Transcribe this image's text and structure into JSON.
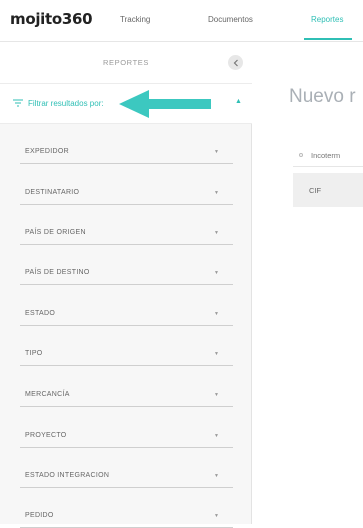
{
  "app": {
    "logo": "mojito360"
  },
  "nav": {
    "items": [
      {
        "label": "Tracking"
      },
      {
        "label": "Documentos"
      },
      {
        "label": "Reportes",
        "active": true
      }
    ]
  },
  "sidebar": {
    "title": "REPORTES",
    "filter_label": "Filtrar resultados por:",
    "fields": [
      {
        "label": "EXPEDIDOR"
      },
      {
        "label": "DESTINATARIO"
      },
      {
        "label": "PAÍS DE ORIGEN"
      },
      {
        "label": "PAÍS DE DESTINO"
      },
      {
        "label": "ESTADO"
      },
      {
        "label": "TIPO"
      },
      {
        "label": "MERCANCÍA"
      },
      {
        "label": "PROYECTO"
      },
      {
        "label": "ESTADO INTEGRACION"
      },
      {
        "label": "PEDIDO"
      }
    ]
  },
  "main": {
    "title": "Nuevo r",
    "incoterm_label": "Incoterm",
    "incoterm_value": "CIF"
  },
  "colors": {
    "accent": "#2fbfb5",
    "arrow": "#3cc8c0"
  },
  "icons": {
    "filter": "filter-lines-icon",
    "collapse": "chevron-left-icon",
    "caret": "caret-down-icon"
  }
}
